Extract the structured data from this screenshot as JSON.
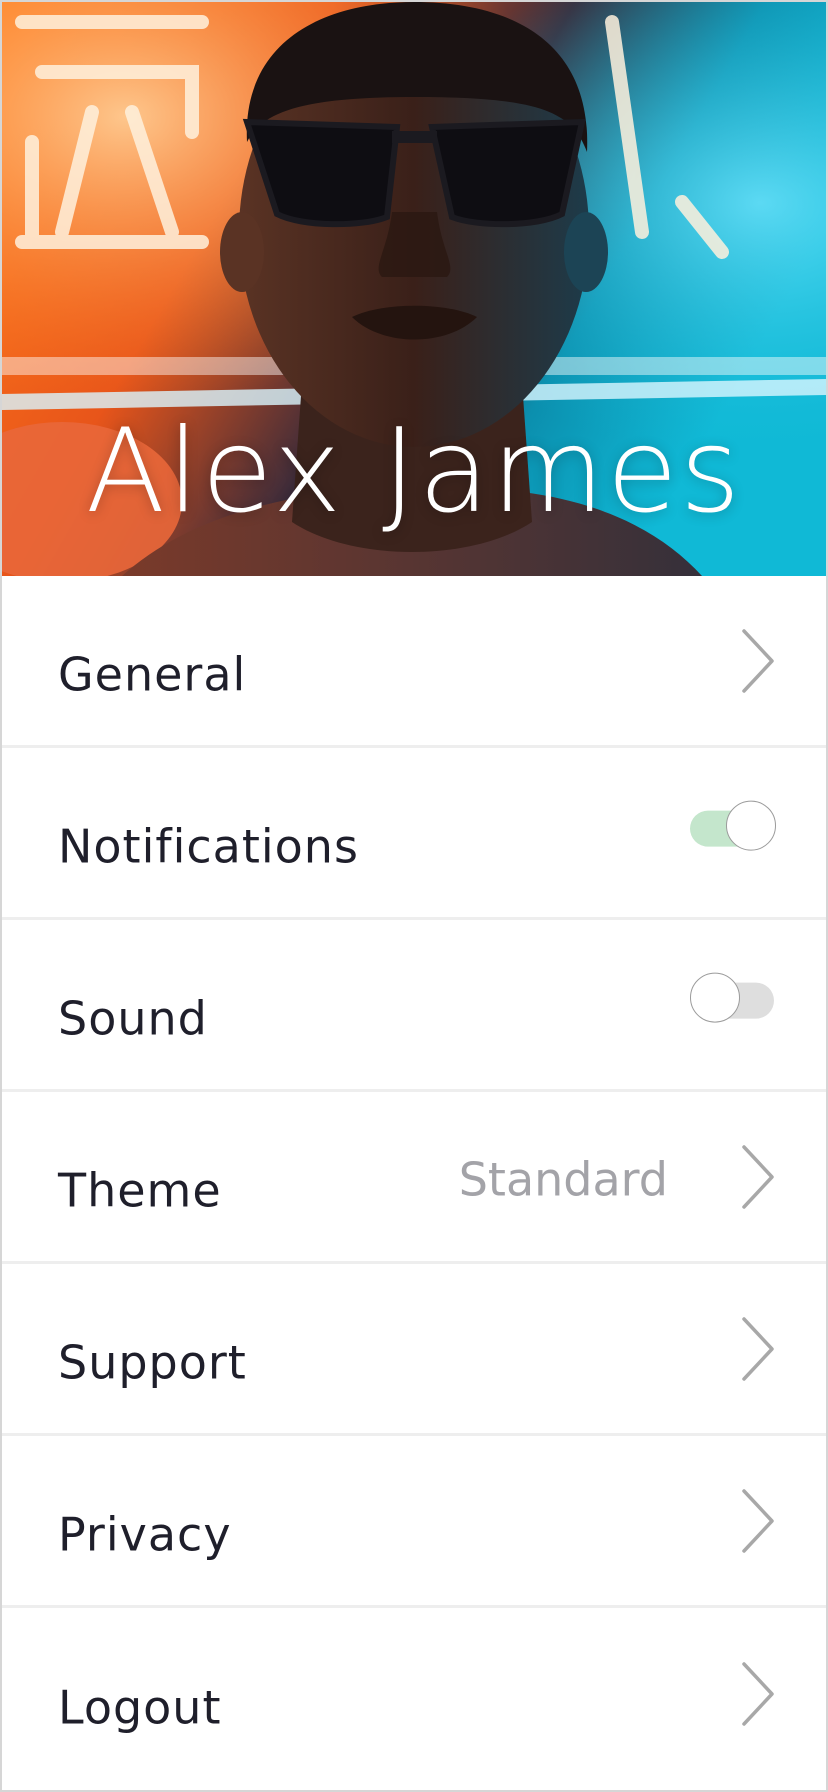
{
  "profile": {
    "name": "Alex James"
  },
  "settings": {
    "general": {
      "label": "General"
    },
    "notifications": {
      "label": "Notifications",
      "enabled": true
    },
    "sound": {
      "label": "Sound",
      "enabled": false
    },
    "theme": {
      "label": "Theme",
      "value": "Standard"
    },
    "support": {
      "label": "Support"
    },
    "privacy": {
      "label": "Privacy"
    },
    "logout": {
      "label": "Logout"
    }
  },
  "colors": {
    "toggle_on_track": "#c4e6cc",
    "toggle_off_track": "#dedede",
    "label_text": "#1f1f2b",
    "value_text": "#a3a3a8",
    "chevron": "#a8a8a8"
  },
  "icons": {
    "row_disclosure": "chevron-right-icon"
  }
}
